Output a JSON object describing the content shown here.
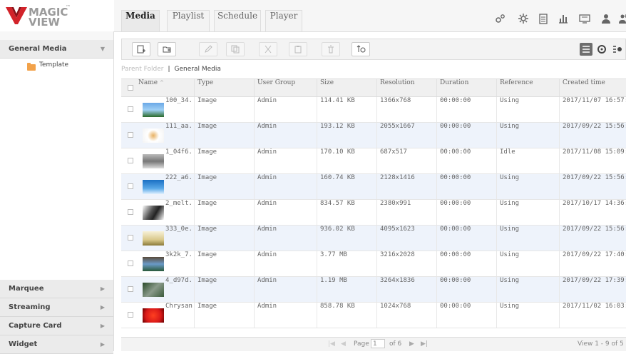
{
  "logo": {
    "line1": "MAGIC",
    "line2": "VIEW",
    "tm": "™"
  },
  "tabs": [
    {
      "label": "Media",
      "active": true
    },
    {
      "label": "Playlist",
      "active": false
    },
    {
      "label": "Schedule",
      "active": false
    },
    {
      "label": "Player",
      "active": false
    }
  ],
  "top_icons": [
    "settings-gears-icon",
    "gear-icon",
    "clipboard-icon",
    "bar-chart-icon",
    "monitor-icon",
    "user-icon",
    "user-add-icon"
  ],
  "sidebar": {
    "general_media": "General Media",
    "tree_item": "Template",
    "sections": [
      "Marquee",
      "Streaming",
      "Capture Card",
      "Widget"
    ]
  },
  "toolbar": {
    "buttons": [
      "add-file-icon",
      "add-folder-icon",
      "edit-icon",
      "copy-icon",
      "cut-icon",
      "paste-icon",
      "delete-icon",
      "send-to-playlist-icon"
    ],
    "view_buttons": [
      "list-view-icon",
      "search-icon",
      "grid-view-icon"
    ]
  },
  "breadcrumb": {
    "parent": "Parent Folder",
    "current": "General Media"
  },
  "table": {
    "columns": [
      "Name",
      "Type",
      "User Group",
      "Size",
      "Resolution",
      "Duration",
      "Reference",
      "Created time"
    ],
    "sort_marker": "^",
    "rows": [
      {
        "name": "100_34...",
        "type": "Image",
        "group": "Admin",
        "size": "114.41 KB",
        "res": "1366x768",
        "dur": "00:00:00",
        "ref": "Using",
        "time": "2017/11/07 16:57:..."
      },
      {
        "name": "111_aa...",
        "type": "Image",
        "group": "Admin",
        "size": "193.12 KB",
        "res": "2055x1667",
        "dur": "00:00:00",
        "ref": "Using",
        "time": "2017/09/22 15:56:..."
      },
      {
        "name": "1_04f6...",
        "type": "Image",
        "group": "Admin",
        "size": "170.10 KB",
        "res": "687x517",
        "dur": "00:00:00",
        "ref": "Idle",
        "time": "2017/11/08 15:09:..."
      },
      {
        "name": "222_a6...",
        "type": "Image",
        "group": "Admin",
        "size": "160.74 KB",
        "res": "2128x1416",
        "dur": "00:00:00",
        "ref": "Using",
        "time": "2017/09/22 15:56:..."
      },
      {
        "name": "2_melt...",
        "type": "Image",
        "group": "Admin",
        "size": "834.57 KB",
        "res": "2380x991",
        "dur": "00:00:00",
        "ref": "Using",
        "time": "2017/10/17 14:36:..."
      },
      {
        "name": "333_0e...",
        "type": "Image",
        "group": "Admin",
        "size": "936.02 KB",
        "res": "4095x1623",
        "dur": "00:00:00",
        "ref": "Using",
        "time": "2017/09/22 15:56:..."
      },
      {
        "name": "3k2k_7...",
        "type": "Image",
        "group": "Admin",
        "size": "3.77 MB",
        "res": "3216x2028",
        "dur": "00:00:00",
        "ref": "Using",
        "time": "2017/09/22 17:40:..."
      },
      {
        "name": "4_d97d...",
        "type": "Image",
        "group": "Admin",
        "size": "1.19 MB",
        "res": "3264x1836",
        "dur": "00:00:00",
        "ref": "Using",
        "time": "2017/09/22 17:39:..."
      },
      {
        "name": "Chrysan...",
        "type": "Image",
        "group": "Admin",
        "size": "858.78 KB",
        "res": "1024x768",
        "dur": "00:00:00",
        "ref": "Using",
        "time": "2017/11/02 16:03:..."
      }
    ]
  },
  "pager": {
    "page_label": "Page",
    "page_value": "1",
    "of_label": "of 6",
    "view_text": "View 1 - 9 of 5"
  },
  "colors": {
    "logo_red": "#d2232a",
    "row_alt": "#eef3fb",
    "folder": "#f2a24a"
  }
}
